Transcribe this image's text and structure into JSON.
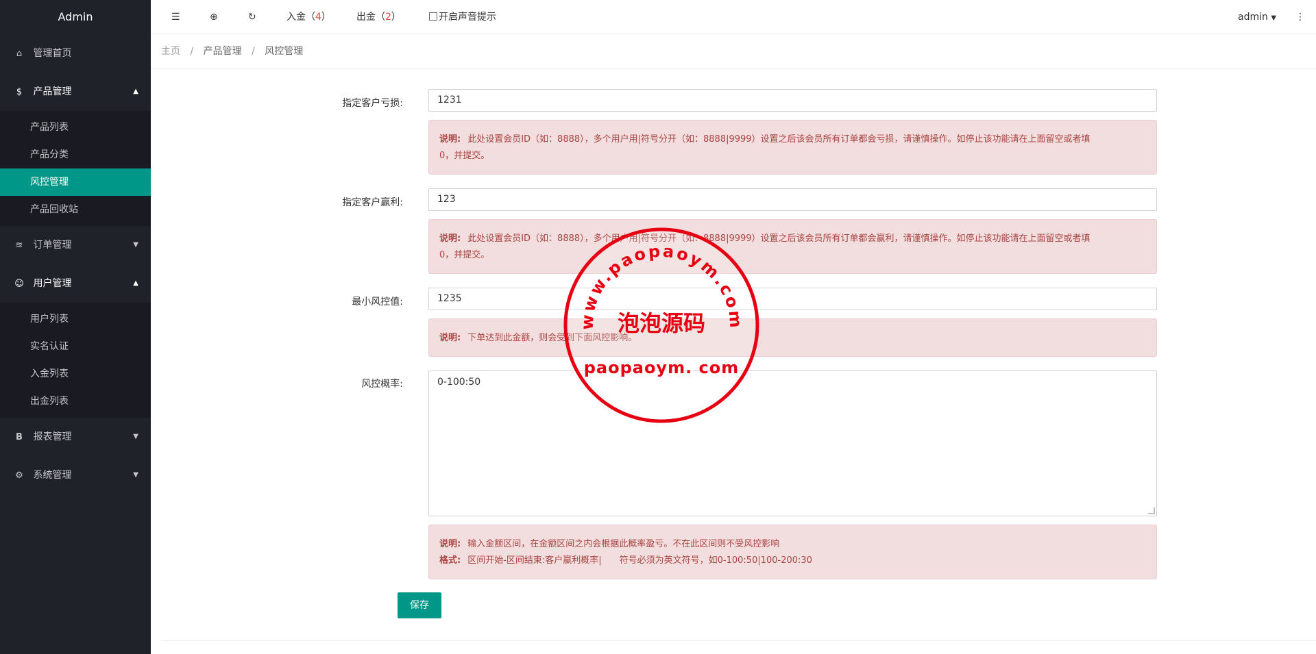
{
  "sidebar": {
    "logo": "Admin",
    "items": [
      {
        "label": "管理首页",
        "icon": "home-icon"
      },
      {
        "label": "产品管理",
        "icon": "dollar-icon",
        "open": true,
        "children": [
          "产品列表",
          "产品分类",
          "风控管理",
          "产品回收站"
        ],
        "active_child": "风控管理"
      },
      {
        "label": "订单管理",
        "icon": "layers-icon"
      },
      {
        "label": "用户管理",
        "icon": "user-icon",
        "open": true,
        "children": [
          "用户列表",
          "实名认证",
          "入金列表",
          "出金列表"
        ]
      },
      {
        "label": "报表管理",
        "icon": "b-icon"
      },
      {
        "label": "系统管理",
        "icon": "gear-icon"
      }
    ]
  },
  "header": {
    "deposit_label": "入金",
    "deposit_count": "4",
    "withdraw_label": "出金",
    "withdraw_count": "2",
    "sound_label": "开启声音提示",
    "user": "admin"
  },
  "breadcrumb": [
    "主页",
    "产品管理",
    "风控管理"
  ],
  "form": {
    "loss_label": "指定客户亏损:",
    "loss_value": "1231",
    "loss_tip_title": "说明:",
    "loss_tip_line1": "此处设置会员ID（如：8888），多个用户用|符号分开（如：8888|9999）设置之后该会员所有订单都会亏损，请谨慎操作。如停止该功能请在上面留空或者填",
    "loss_tip_line2": "0，并提交。",
    "profit_label": "指定客户赢利:",
    "profit_value": "123",
    "profit_tip_title": "说明:",
    "profit_tip_line1": "此处设置会员ID（如：8888），多个用户用|符号分开（如：8888|9999）设置之后该会员所有订单都会赢利，请谨慎操作。如停止该功能请在上面留空或者填",
    "profit_tip_line2": "0，并提交。",
    "min_label": "最小风控值:",
    "min_value": "1235",
    "min_tip_title": "说明:",
    "min_tip_text": "下单达到此金额，则会受到下面风控影响。",
    "rate_label": "风控概率:",
    "rate_value": "0-100:50",
    "rate_tip_title": "说明:",
    "rate_tip_text": "输入金额区间，在金额区间之内会根据此概率盈亏。不在此区间则不受风控影响",
    "rate_format_title": "格式:",
    "rate_format_text": "区间开始-区间结束:客户赢利概率|　　符号必须为英文符号，如0-100:50|100-200:30",
    "save_label": "保存"
  },
  "watermark": {
    "arc_text": "www.paopaoym.com",
    "center_text": "泡泡源码",
    "bottom_text": "paopaoym. com",
    "color": "#e60012"
  }
}
